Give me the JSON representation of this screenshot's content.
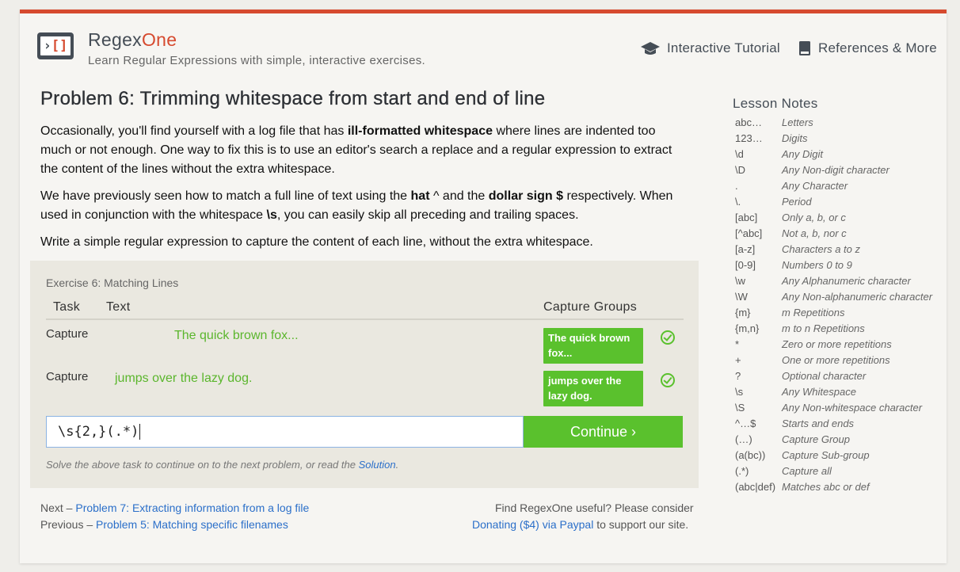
{
  "header": {
    "brand_regex": "Regex",
    "brand_one": "One",
    "tagline": "Learn Regular Expressions with simple, interactive exercises.",
    "nav": [
      {
        "label": "Interactive Tutorial",
        "icon": "graduation-cap-icon"
      },
      {
        "label": "References & More",
        "icon": "book-icon"
      }
    ]
  },
  "colors": {
    "accent": "#d64a2f",
    "success": "#5ac12d",
    "link": "#2b6fc9"
  },
  "problem": {
    "title": "Problem 6: Trimming whitespace from start and end of line",
    "p1_a": "Occasionally, you'll find yourself with a log file that has ",
    "p1_b": "ill-formatted whitespace",
    "p1_c": " where lines are indented too much or not enough. One way to fix this is to use an editor's search a replace and a regular expression to extract the content of the lines without the extra whitespace.",
    "p2_a": "We have previously seen how to match a full line of text using the ",
    "p2_b": "hat",
    "p2_c": " ^ and the ",
    "p2_d": "dollar sign $",
    "p2_e": " respectively. When used in conjunction with the whitespace ",
    "p2_f": "\\s",
    "p2_g": ", you can easily skip all preceding and trailing spaces.",
    "p3": "Write a simple regular expression to capture the content of each line, without the extra whitespace."
  },
  "exercise": {
    "title": "Exercise 6: Matching Lines",
    "col_task": "Task",
    "col_text": "Text",
    "col_capture": "Capture Groups",
    "rows": [
      {
        "task": "Capture",
        "text": "The quick brown fox...",
        "capture": "The quick brown fox..."
      },
      {
        "task": "Capture",
        "text": "jumps over the lazy dog.",
        "capture": "jumps over the lazy dog."
      }
    ],
    "input_value": "\\s{2,}(.*)",
    "continue_label": "Continue ›",
    "hint_a": "Solve the above task to continue on to the next problem, or read the ",
    "hint_link": "Solution",
    "hint_b": "."
  },
  "footer": {
    "next_prefix": "Next – ",
    "next_link": "Problem 7: Extracting information from a log file",
    "prev_prefix": "Previous – ",
    "prev_link": "Problem 5: Matching specific filenames",
    "donate_text": "Find RegexOne useful? Please consider",
    "donate_link": "Donating ($4) via Paypal",
    "donate_suffix": " to support our site."
  },
  "lesson_notes": {
    "title": "Lesson Notes",
    "items": [
      {
        "sym": "abc…",
        "desc": "Letters"
      },
      {
        "sym": "123…",
        "desc": "Digits"
      },
      {
        "sym": "\\d",
        "desc": "Any Digit"
      },
      {
        "sym": "\\D",
        "desc": "Any Non-digit character"
      },
      {
        "sym": ".",
        "desc": "Any Character"
      },
      {
        "sym": "\\.",
        "desc": "Period"
      },
      {
        "sym": "[abc]",
        "desc": "Only a, b, or c"
      },
      {
        "sym": "[^abc]",
        "desc": "Not a, b, nor c"
      },
      {
        "sym": "[a-z]",
        "desc": "Characters a to z"
      },
      {
        "sym": "[0-9]",
        "desc": "Numbers 0 to 9"
      },
      {
        "sym": "\\w",
        "desc": "Any Alphanumeric character"
      },
      {
        "sym": "\\W",
        "desc": "Any Non-alphanumeric character"
      },
      {
        "sym": "{m}",
        "desc": "m Repetitions"
      },
      {
        "sym": "{m,n}",
        "desc": "m to n Repetitions"
      },
      {
        "sym": "*",
        "desc": "Zero or more repetitions"
      },
      {
        "sym": "+",
        "desc": "One or more repetitions"
      },
      {
        "sym": "?",
        "desc": "Optional character"
      },
      {
        "sym": "\\s",
        "desc": "Any Whitespace"
      },
      {
        "sym": "\\S",
        "desc": "Any Non-whitespace character"
      },
      {
        "sym": "^…$",
        "desc": "Starts and ends"
      },
      {
        "sym": "(…)",
        "desc": "Capture Group"
      },
      {
        "sym": "(a(bc))",
        "desc": "Capture Sub-group"
      },
      {
        "sym": "(.*)",
        "desc": "Capture all"
      },
      {
        "sym": "(abc|def)",
        "desc": "Matches abc or def"
      }
    ]
  }
}
